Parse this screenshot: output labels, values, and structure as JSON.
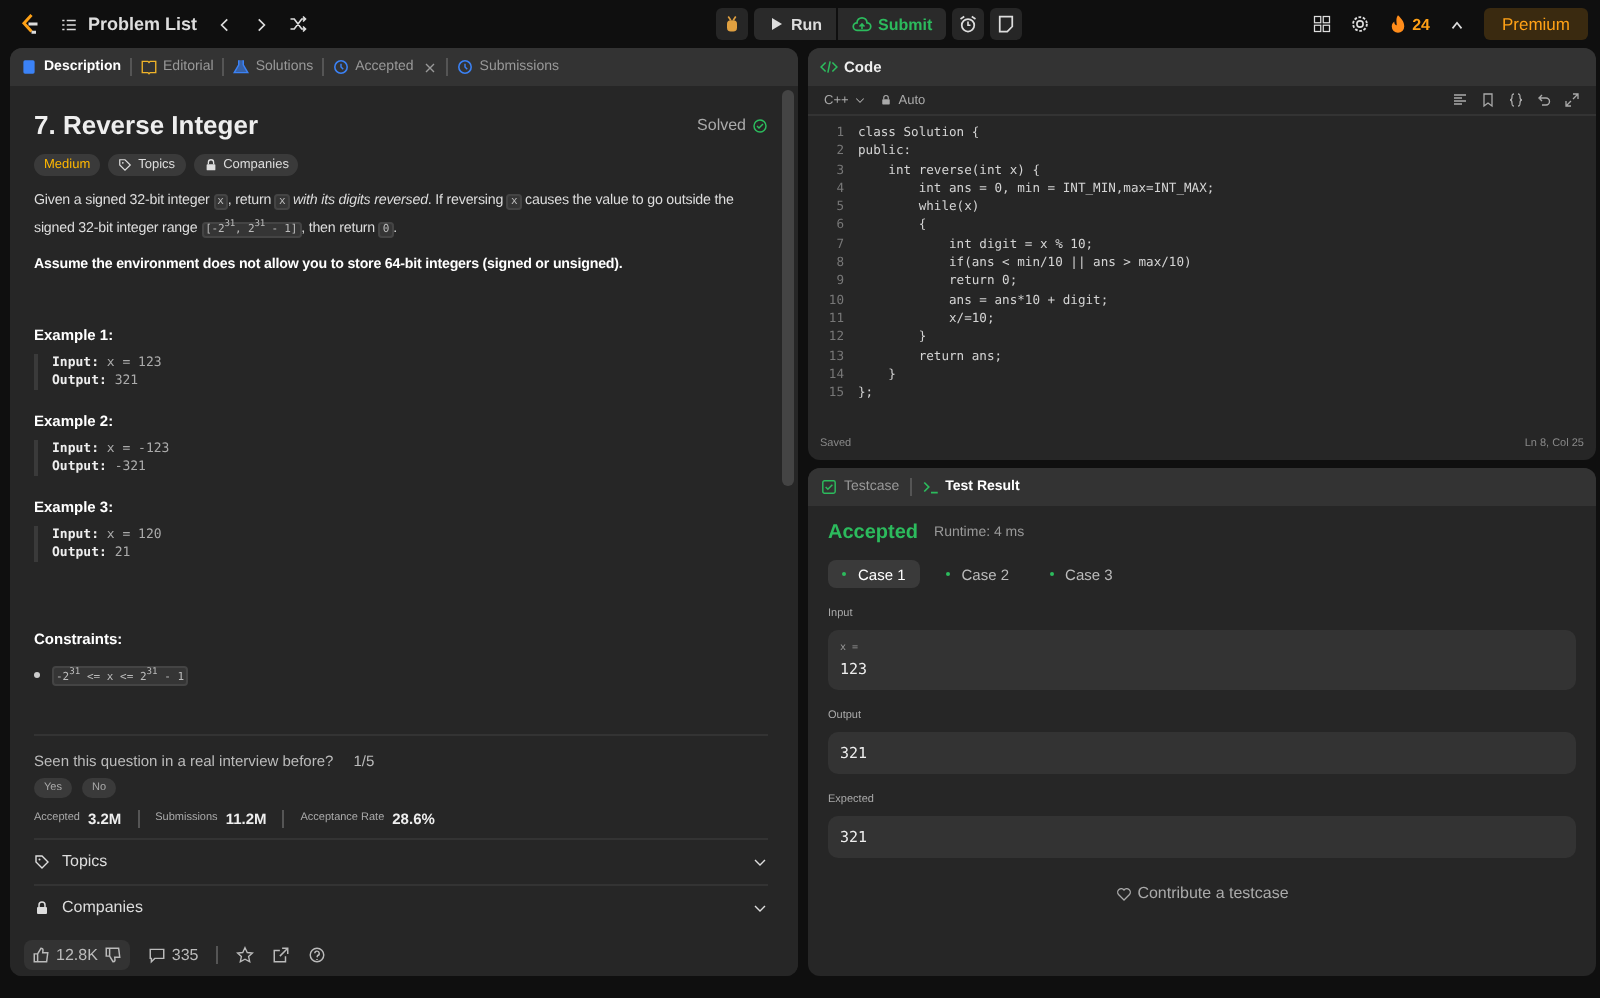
{
  "topbar": {
    "problem_list": "Problem List",
    "run": "Run",
    "submit": "Submit",
    "streak": "24",
    "premium": "Premium"
  },
  "description_tabs": [
    {
      "label": "Description",
      "selected": true,
      "kind": "doc"
    },
    {
      "label": "Editorial",
      "selected": false,
      "kind": "book"
    },
    {
      "label": "Solutions",
      "selected": false,
      "kind": "flask"
    },
    {
      "label": "Accepted",
      "selected": false,
      "kind": "history",
      "closable": true
    },
    {
      "label": "Submissions",
      "selected": false,
      "kind": "history"
    }
  ],
  "problem": {
    "title": "7. Reverse Integer",
    "status": "Solved",
    "difficulty": "Medium",
    "tags": [
      {
        "label": "Topics",
        "kind": "tag"
      },
      {
        "label": "Companies",
        "kind": "lock"
      }
    ],
    "statement": [
      {
        "kind": "text",
        "text": "Given a signed 32-bit integer "
      },
      {
        "kind": "code",
        "text": "x"
      },
      {
        "kind": "text",
        "text": ", return "
      },
      {
        "kind": "code",
        "text": "x"
      },
      {
        "kind": "text",
        "text": " *with its digits reversed*. If reversing "
      },
      {
        "kind": "code",
        "text": "x"
      },
      {
        "kind": "text",
        "text": " causes the value to go outside the signed 32-bit integer range "
      },
      {
        "kind": "code",
        "text": "[-2$^{31}$, 2$^{31}$ - 1]"
      },
      {
        "kind": "text",
        "text": ", then return "
      },
      {
        "kind": "code",
        "text": "0"
      },
      {
        "kind": "text",
        "text": "."
      }
    ],
    "note": "Assume the environment does not allow you to store 64-bit integers (signed or unsigned).",
    "examples": [
      {
        "title": "Example 1:",
        "lines": [
          "**Input:** x = 123",
          "**Output:** 321"
        ]
      },
      {
        "title": "Example 2:",
        "lines": [
          "**Input:** x = -123",
          "**Output:** -321"
        ]
      },
      {
        "title": "Example 3:",
        "lines": [
          "**Input:** x = 120",
          "**Output:** 21"
        ]
      }
    ],
    "constraints_title": "Constraints:",
    "constraints": [
      "-2$^{31}$ <= x <= 2$^{31}$ - 1"
    ],
    "interview": {
      "question": "Seen this question in a real interview before?",
      "count": "1/5",
      "buttons": [
        "Yes",
        "No"
      ]
    },
    "stats": [
      {
        "label": "Accepted",
        "value": "3.2M"
      },
      {
        "label": "Submissions",
        "value": "11.2M"
      },
      {
        "label": "Acceptance Rate",
        "value": "28.6%"
      }
    ],
    "sections": [
      {
        "label": "Topics",
        "kind": "tag"
      },
      {
        "label": "Companies",
        "kind": "lock"
      }
    ]
  },
  "footer": {
    "likes": "12.8K",
    "comments": "335"
  },
  "code": {
    "title": "Code",
    "language": "C++",
    "mode": "Auto",
    "status": "Saved",
    "cursor": "Ln 8, Col 25",
    "lines": [
      {
        "n": "1",
        "text": "class Solution {"
      },
      {
        "n": "2",
        "text": "public:"
      },
      {
        "n": "3",
        "text": "    int reverse(int x) {"
      },
      {
        "n": "4",
        "text": "        int ans = 0, min = INT_MIN,max=INT_MAX;"
      },
      {
        "n": "5",
        "text": "        while(x)"
      },
      {
        "n": "6",
        "text": "        {"
      },
      {
        "n": "7",
        "text": "            int digit = x % 10;"
      },
      {
        "n": "8",
        "text": "            if(ans < min/10 || ans > max/10)"
      },
      {
        "n": "9",
        "text": "            return 0;"
      },
      {
        "n": "10",
        "text": "            ans = ans*10 + digit;"
      },
      {
        "n": "11",
        "text": "            x/=10;"
      },
      {
        "n": "12",
        "text": "        }"
      },
      {
        "n": "13",
        "text": "        return ans;"
      },
      {
        "n": "14",
        "text": "    }"
      },
      {
        "n": "15",
        "text": "};"
      }
    ]
  },
  "result": {
    "tabs": [
      {
        "label": "Testcase",
        "selected": false,
        "kind": "check"
      },
      {
        "label": "Test Result",
        "selected": true,
        "kind": "terminal"
      }
    ],
    "verdict": "Accepted",
    "runtime": "Runtime: 4 ms",
    "cases": [
      {
        "label": "Case 1",
        "selected": true
      },
      {
        "label": "Case 2",
        "selected": false
      },
      {
        "label": "Case 3",
        "selected": false
      }
    ],
    "fields": [
      {
        "label": "Input",
        "var": "x =",
        "value": "123"
      },
      {
        "label": "Output",
        "value": "321"
      },
      {
        "label": "Expected",
        "value": "321"
      }
    ],
    "contribute": "Contribute a testcase"
  }
}
